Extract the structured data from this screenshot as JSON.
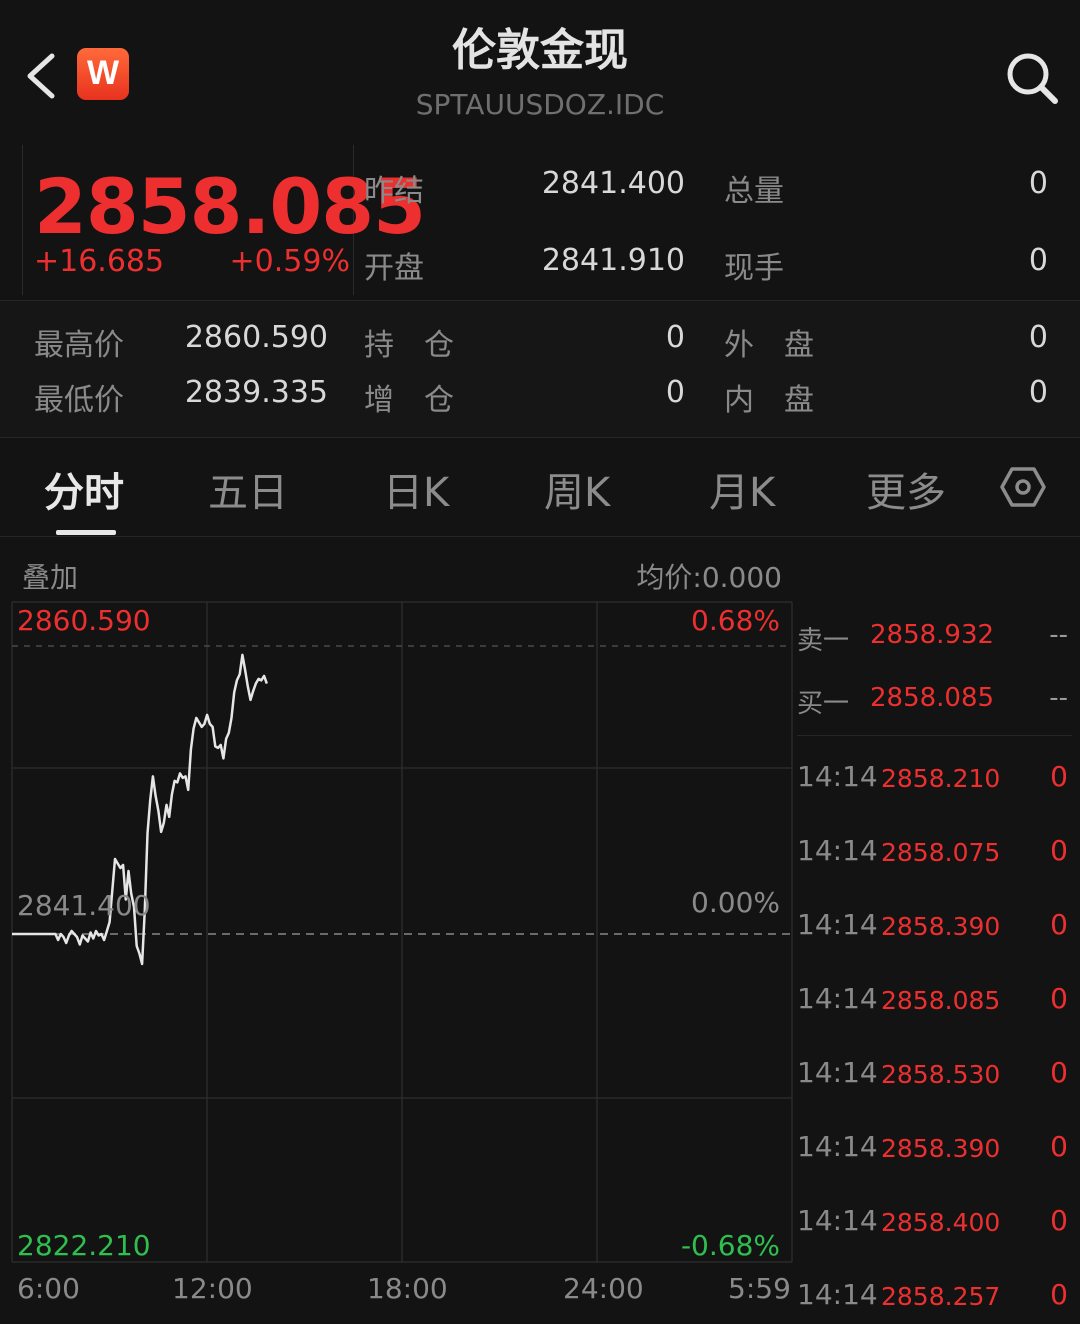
{
  "header": {
    "title": "伦敦金现",
    "subtitle": "SPTAUUSDOZ.IDC",
    "logo_text": "W",
    "icons": {
      "back": "chevron-left-icon",
      "search": "search-icon"
    }
  },
  "quote": {
    "last_price": "2858.085",
    "change": "+16.685",
    "change_pct": "+0.59%",
    "prev_settle_label": "昨结",
    "prev_settle": "2841.400",
    "open_label": "开盘",
    "open": "2841.910",
    "total_vol_label": "总量",
    "total_vol": "0",
    "cur_hand_label": "现手",
    "cur_hand": "0"
  },
  "stats": {
    "high_label": "最高价",
    "high": "2860.590",
    "low_label": "最低价",
    "low": "2839.335",
    "open_interest_label": "持　仓",
    "open_interest": "0",
    "oi_change_label": "增　仓",
    "oi_change": "0",
    "outer_label": "外　盘",
    "outer": "0",
    "inner_label": "内　盘",
    "inner": "0"
  },
  "tabs": [
    {
      "label": "分时",
      "active": true
    },
    {
      "label": "五日",
      "active": false
    },
    {
      "label": "日K",
      "active": false
    },
    {
      "label": "周K",
      "active": false
    },
    {
      "label": "月K",
      "active": false
    },
    {
      "label": "更多",
      "active": false
    }
  ],
  "tabs_settings_icon": "hexagon-settings-icon",
  "chart_header": {
    "overlay": "叠加",
    "avg_price": "均价:0.000"
  },
  "chart_data": {
    "type": "line",
    "y_top_label": "2860.590",
    "y_mid_label": "2841.400",
    "y_bottom_label": "2822.210",
    "pct_top": "0.68%",
    "pct_mid": "0.00%",
    "pct_bottom": "-0.68%",
    "ylim": [
      2822.21,
      2860.59
    ],
    "baseline": 2841.4,
    "x_tick_labels": [
      "6:00",
      "12:00",
      "18:00",
      "24:00",
      "5:59"
    ],
    "x_minutes_from_start": [
      0,
      10,
      20,
      30,
      40,
      50,
      60,
      70,
      80,
      85,
      90,
      95,
      100,
      105,
      110,
      120,
      125,
      130,
      135,
      140,
      145,
      150,
      155,
      160,
      165,
      170,
      175,
      180,
      190,
      200,
      205,
      210,
      215,
      220,
      225,
      230,
      235,
      240,
      245,
      250,
      255,
      260,
      265,
      270,
      275,
      280,
      285,
      290,
      295,
      300,
      305,
      310,
      315,
      320,
      325,
      330,
      335,
      340,
      345,
      350,
      355,
      360,
      365,
      370,
      375,
      380,
      385,
      390,
      395,
      400,
      405,
      410,
      415,
      420,
      425,
      430,
      435,
      440,
      445,
      450,
      455,
      460,
      465,
      470
    ],
    "values": [
      2841.4,
      2841.4,
      2841.4,
      2841.4,
      2841.4,
      2841.4,
      2841.4,
      2841.4,
      2841.4,
      2841.0,
      2841.4,
      2841.2,
      2840.8,
      2841.3,
      2841.6,
      2841.2,
      2840.7,
      2841.3,
      2841.1,
      2840.9,
      2841.5,
      2841.1,
      2841.6,
      2841.3,
      2841.4,
      2841.0,
      2841.6,
      2842.2,
      2846.4,
      2845.8,
      2846.0,
      2843.7,
      2845.6,
      2844.1,
      2843.2,
      2840.6,
      2840.1,
      2839.4,
      2843.0,
      2848.1,
      2850.3,
      2851.9,
      2850.6,
      2849.6,
      2848.2,
      2848.8,
      2850.0,
      2849.2,
      2850.7,
      2851.6,
      2851.5,
      2852.1,
      2851.8,
      2851.9,
      2851.0,
      2853.7,
      2855.1,
      2855.8,
      2855.5,
      2855.2,
      2855.4,
      2856.0,
      2855.4,
      2855.2,
      2853.9,
      2853.8,
      2854.0,
      2853.1,
      2854.4,
      2854.8,
      2855.8,
      2857.5,
      2858.3,
      2858.7,
      2860.0,
      2859.0,
      2857.9,
      2857.0,
      2857.6,
      2858.1,
      2858.4,
      2858.3,
      2858.6,
      2858.085
    ]
  },
  "orderbook": {
    "ask_label": "卖一",
    "ask_price": "2858.932",
    "ask_vol": "--",
    "bid_label": "买一",
    "bid_price": "2858.085",
    "bid_vol": "--"
  },
  "trades": [
    {
      "time": "14:14",
      "price": "2858.210",
      "vol": "0"
    },
    {
      "time": "14:14",
      "price": "2858.075",
      "vol": "0"
    },
    {
      "time": "14:14",
      "price": "2858.390",
      "vol": "0"
    },
    {
      "time": "14:14",
      "price": "2858.085",
      "vol": "0"
    },
    {
      "time": "14:14",
      "price": "2858.530",
      "vol": "0"
    },
    {
      "time": "14:14",
      "price": "2858.390",
      "vol": "0"
    },
    {
      "time": "14:14",
      "price": "2858.400",
      "vol": "0"
    },
    {
      "time": "14:14",
      "price": "2858.257",
      "vol": "0"
    }
  ],
  "colors": {
    "up": "#ee2f2f",
    "down": "#2fbf4f",
    "line": "#e6e6e6",
    "background": "#131313"
  }
}
